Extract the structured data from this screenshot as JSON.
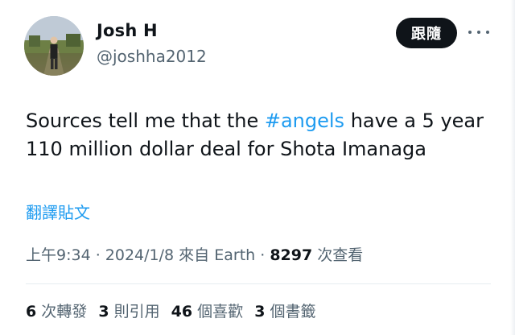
{
  "author": {
    "display_name": "Josh H",
    "handle": "@joshha2012"
  },
  "header": {
    "follow_label": "跟隨",
    "more_icon": "more-icon"
  },
  "tweet": {
    "text_part1": "Sources tell me that the ",
    "hashtag": "#angels",
    "text_part2": " have a 5 year",
    "text_line2": "110 million dollar deal for Shota Imanaga"
  },
  "translate": {
    "label": "翻譯貼文"
  },
  "meta": {
    "time": "上午9:34",
    "sep1": " · ",
    "date": "2024/1/8",
    "source_prefix": " 來自 ",
    "source": "Earth",
    "sep2": " · ",
    "views_count": "8297",
    "views_label": " 次查看"
  },
  "stats": {
    "retweets_count": "6",
    "retweets_label": " 次轉發",
    "quotes_count": "3",
    "quotes_label": " 則引用",
    "likes_count": "46",
    "likes_label": " 個喜歡",
    "bookmarks_count": "3",
    "bookmarks_label": " 個書籤"
  },
  "colors": {
    "accent": "#1d9bf0",
    "text": "#0f1419",
    "secondary_text": "#536471",
    "divider": "#e6ecf0"
  }
}
